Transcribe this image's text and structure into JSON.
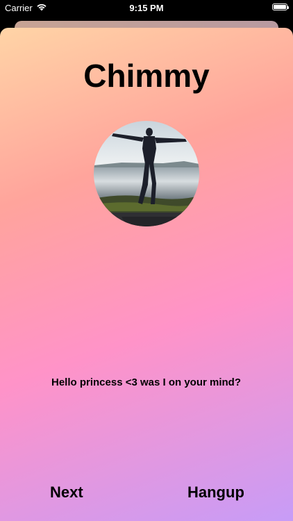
{
  "status_bar": {
    "carrier": "Carrier",
    "time": "9:15 PM",
    "wifi_icon": "wifi-icon",
    "battery_icon": "battery-icon",
    "battery_level": 1.0
  },
  "call": {
    "caller_name": "Chimmy",
    "avatar_icon": "profile-photo",
    "message": "Hello princess <3 was I on your mind?"
  },
  "actions": {
    "next_label": "Next",
    "hangup_label": "Hangup"
  },
  "colors": {
    "gradient_top": "#ffd4a6",
    "gradient_mid": "#ff93c8",
    "gradient_bottom": "#c79cf7",
    "text": "#000000"
  }
}
